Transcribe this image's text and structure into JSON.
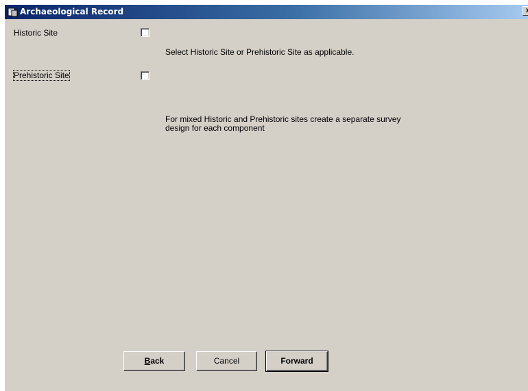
{
  "window": {
    "title": "Archaeological Record",
    "close_glyph": "x"
  },
  "form": {
    "historic_label": "Historic Site",
    "prehistoric_label": "Prehistoric Site",
    "historic_checked": false,
    "prehistoric_checked": false,
    "hint_select": "Select Historic Site or Prehistoric Site as applicable.",
    "hint_mixed_line1": "For mixed Historic and Prehistoric sites create a separate survey",
    "hint_mixed_line2": "design for each component"
  },
  "buttons": {
    "back_mnemonic": "B",
    "back_rest": "ack",
    "cancel": "Cancel",
    "forward": "Forward"
  },
  "colors": {
    "face": "#d4d0c8",
    "title_start": "#0a246a",
    "title_end": "#a6caf0"
  }
}
